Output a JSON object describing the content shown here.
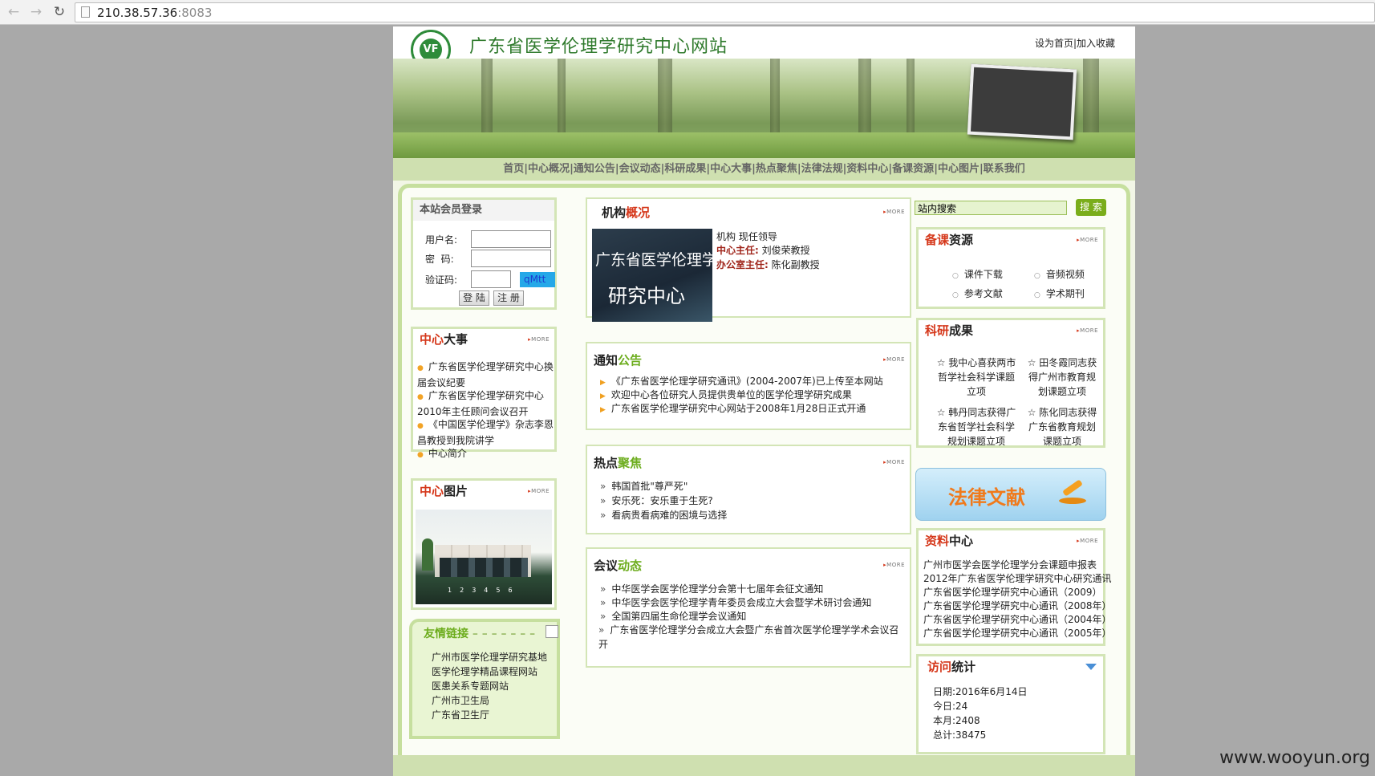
{
  "browser": {
    "back_glyph": "←",
    "forward_glyph": "→",
    "reload_glyph": "↻",
    "url_host": "210.38.57.36",
    "url_port": ":8083",
    "icons": [
      "back-icon",
      "forward-icon",
      "reload-icon",
      "page-icon"
    ]
  },
  "header": {
    "title": "广东省医学伦理学研究中心网站",
    "logo_text": "VF",
    "top_links": "设为首页|加入收藏"
  },
  "nav": {
    "items": [
      "首页",
      "中心概况",
      "通知公告",
      "会议动态",
      "科研成果",
      "中心大事",
      "热点聚焦",
      "法律法规",
      "资料中心",
      "备课资源",
      "中心图片",
      "联系我们"
    ],
    "separator": "|"
  },
  "login": {
    "title": "本站会员登录",
    "username_label": "用户名:",
    "password_label": "密  码:",
    "captcha_label": "验证码:",
    "captcha_code": "qMtt",
    "login_button": "登 陆",
    "register_button": "注 册"
  },
  "events": {
    "title_red": "中心",
    "title_black": "大事",
    "more": "MORE",
    "items": [
      "广东省医学伦理学研究中心换届会议纪要",
      "广东省医学伦理学研究中心2010年主任顾问会议召开",
      "《中国医学伦理学》杂志李恩昌教授到我院讲学",
      "中心简介"
    ]
  },
  "pictures": {
    "title_red": "中心",
    "title_black": "图片",
    "more": "MORE",
    "pages": [
      "1",
      "2",
      "3",
      "4",
      "5",
      "6"
    ]
  },
  "friend_links": {
    "title": "友情链接",
    "items": [
      "广州市医学伦理学研究基地",
      "医学伦理学精品课程网站",
      "医患关系专题网站",
      "广州市卫生局",
      "广东省卫生厅"
    ]
  },
  "org": {
    "title_black": "机构",
    "title_red": "概况",
    "more": "MORE",
    "image_text_1": "广东省医学伦理学",
    "image_text_2": "研究中心",
    "leader_header": "机构 现任领导",
    "director_label": "中心主任:",
    "director_name": "刘俊荣教授",
    "office_label": "办公室主任:",
    "office_name": "陈化副教授"
  },
  "notice": {
    "title_black": "通知",
    "title_green": "公告",
    "more": "MORE",
    "items": [
      "《广东省医学伦理学研究通讯》(2004-2007年)已上传至本网站",
      "欢迎中心各位研究人员提供贵单位的医学伦理学研究成果",
      "广东省医学伦理学研究中心网站于2008年1月28日正式开通"
    ]
  },
  "hot": {
    "title_black": "热点",
    "title_green": "聚焦",
    "more": "MORE",
    "items": [
      "韩国首批\"尊严死\"",
      "安乐死：安乐重于生死?",
      "看病贵看病难的困境与选择"
    ]
  },
  "meeting": {
    "title_black": "会议",
    "title_green": "动态",
    "more": "MORE",
    "items": [
      "中华医学会医学伦理学分会第十七届年会征文通知",
      "中华医学会医学伦理学青年委员会成立大会暨学术研讨会通知",
      "全国第四届生命伦理学会议通知",
      "广东省医学伦理学分会成立大会暨广东省首次医学伦理学学术会议召开"
    ]
  },
  "search": {
    "placeholder": "站内搜索",
    "button": "搜 索"
  },
  "resources": {
    "title_red": "备课",
    "title_black": "资源",
    "more": "MORE",
    "items": [
      "课件下载",
      "音频视频",
      "参考文献",
      "学术期刊"
    ]
  },
  "research": {
    "title_red": "科研",
    "title_black": "成果",
    "more": "MORE",
    "items": [
      "☆ 我中心喜获两市哲学社会科学课题立项",
      "☆ 田冬霞同志获得广州市教育规划课题立项",
      "☆ 韩丹同志获得广东省哲学社会科学规划课题立项",
      "☆ 陈化同志获得广东省教育规划课题立项"
    ]
  },
  "law_banner": {
    "text": "法律文献"
  },
  "docs": {
    "title_red": "资料",
    "title_black": "中心",
    "more": "MORE",
    "items": [
      "广州市医学会医学伦理学分会课题申报表",
      "2012年广东省医学伦理学研究中心研究通讯",
      "广东省医学伦理学研究中心通讯（2009）",
      "广东省医学伦理学研究中心通讯（2008年）",
      "广东省医学伦理学研究中心通讯（2004年）",
      "广东省医学伦理学研究中心通讯（2005年）"
    ]
  },
  "stats": {
    "title_red": "访问",
    "title_black": "统计",
    "date": "日期:2016年6月14日",
    "today": "今日:24",
    "month": "本月:2408",
    "total": "总计:38475"
  },
  "watermark": "www.wooyun.org"
}
